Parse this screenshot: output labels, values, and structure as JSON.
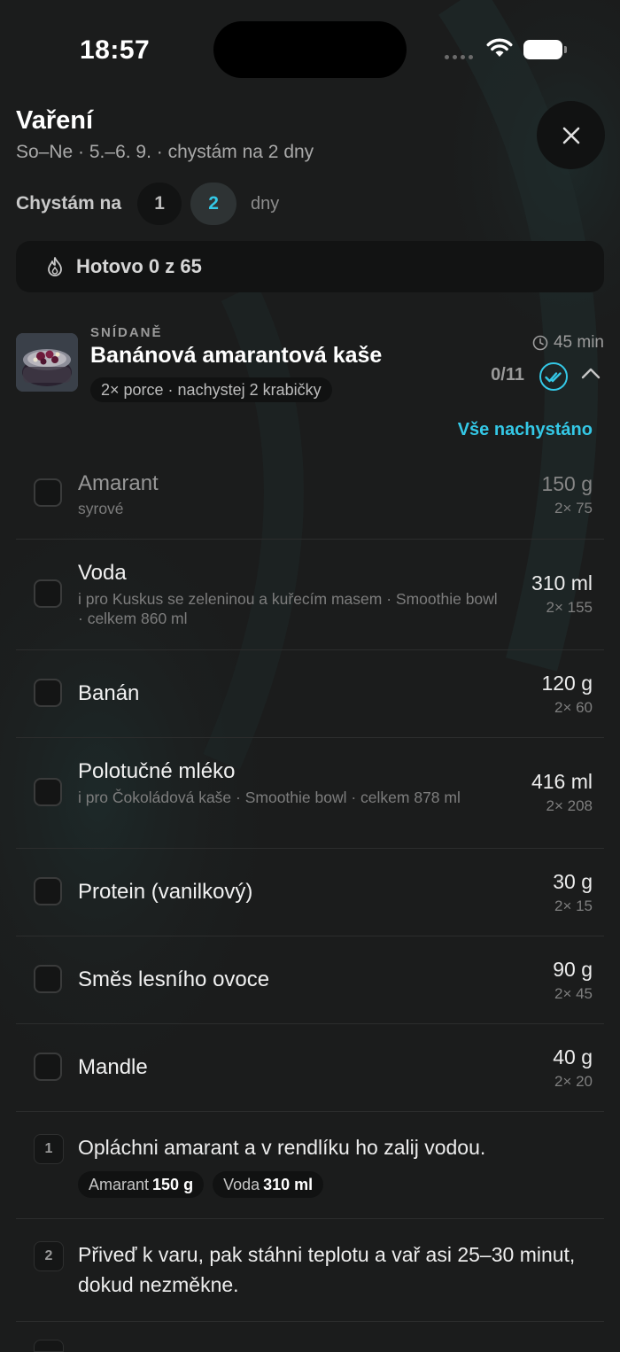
{
  "status_bar": {
    "time": "18:57"
  },
  "header": {
    "title": "Vaření",
    "subtitle": "So–Ne · 5.–6. 9. · chystám na 2 dny"
  },
  "days_selector": {
    "label": "Chystám na",
    "options": [
      "1",
      "2"
    ],
    "selected": "2",
    "suffix": "dny"
  },
  "progress": {
    "text": "Hotovo 0 z 65"
  },
  "recipe": {
    "meal": "SNÍDANĚ",
    "title": "Banánová amarantová kaše",
    "tag": "2× porce · nachystej 2 krabičky",
    "duration": "45 min",
    "count": "0/11",
    "all_done_label": "Vše nachystáno"
  },
  "ingredients": [
    {
      "name": "Amarant",
      "note": "syrové",
      "amount": "150 g",
      "per": "2× 75",
      "dim": true
    },
    {
      "name": "Voda",
      "note": "i pro Kuskus se zeleninou a kuřecím masem · Smoothie bowl · celkem 860 ml",
      "amount": "310 ml",
      "per": "2× 155"
    },
    {
      "name": "Banán",
      "note": "",
      "amount": "120 g",
      "per": "2× 60"
    },
    {
      "name": "Polotučné mléko",
      "note": "i pro Čokoládová kaše · Smoothie bowl · celkem 878 ml",
      "amount": "416 ml",
      "per": "2× 208"
    },
    {
      "name": "Protein (vanilkový)",
      "note": "",
      "amount": "30 g",
      "per": "2× 15"
    },
    {
      "name": "Směs lesního ovoce",
      "note": "",
      "amount": "90 g",
      "per": "2× 45"
    },
    {
      "name": "Mandle",
      "note": "",
      "amount": "40 g",
      "per": "2× 20"
    }
  ],
  "steps": [
    {
      "num": "1",
      "text": "Opláchni amarant a v rendlíku ho zalij vodou.",
      "chips": [
        {
          "name": "Amarant",
          "amount": "150 g"
        },
        {
          "name": "Voda",
          "amount": "310 ml"
        }
      ]
    },
    {
      "num": "2",
      "text": "Přiveď k varu, pak stáhni teplotu a vař asi 25–30 minut, dokud nezměkne.",
      "chips": []
    }
  ],
  "colors": {
    "accent": "#34c8e6",
    "background": "#1b1c1c",
    "surface": "#121313"
  }
}
